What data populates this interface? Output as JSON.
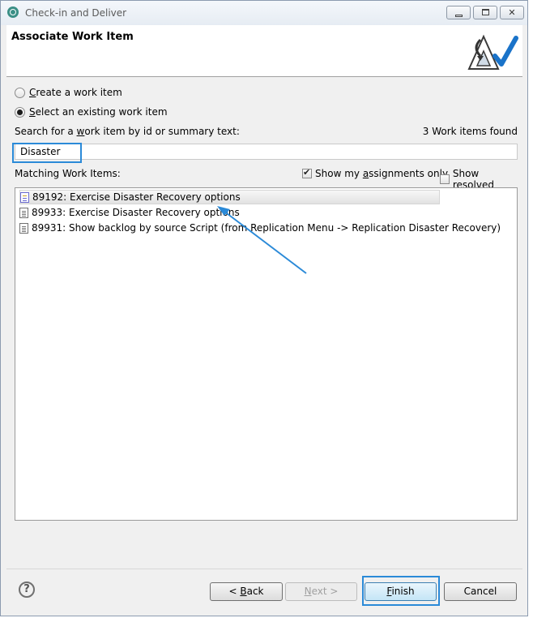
{
  "window": {
    "title": "Check-in and Deliver",
    "controls": {
      "minimize": "",
      "maximize": "",
      "close": "✕"
    }
  },
  "header": {
    "title": "Associate Work Item"
  },
  "options": {
    "create_pre": "",
    "create_u": "C",
    "create_post": "reate a work item",
    "select_pre": "",
    "select_u": "S",
    "select_post": "elect an existing work item",
    "selected": "select_existing"
  },
  "search": {
    "label_pre": "Search for a ",
    "label_u": "w",
    "label_post": "ork item by id or summary text:",
    "value": "Disaster",
    "found_text": "3 Work items found"
  },
  "matching": {
    "label": "Matching Work Items:",
    "show_mine_pre": "Show my ",
    "show_mine_u": "a",
    "show_mine_post": "ssignments only",
    "show_mine_checked": true,
    "show_resolved_pre": "Show ",
    "show_resolved_u": "r",
    "show_resolved_post": "esolved",
    "show_resolved_checked": false
  },
  "work_items": [
    {
      "text": "89192: Exercise Disaster Recovery options",
      "icon": "story-icon",
      "selected": true
    },
    {
      "text": "89933: Exercise Disaster Recovery options",
      "icon": "task-icon",
      "selected": false
    },
    {
      "text": "89931: Show backlog by source Script (from Replication Menu -> Replication Disaster Recovery)",
      "icon": "task-icon",
      "selected": false
    }
  ],
  "buttons": {
    "back_pre": "< ",
    "back_u": "B",
    "back_post": "ack",
    "next_pre": "",
    "next_u": "N",
    "next_post": "ext >",
    "finish_pre": "",
    "finish_u": "F",
    "finish_post": "inish",
    "cancel": "Cancel",
    "help": "?"
  },
  "colors": {
    "highlight": "#2b8ad8",
    "arrow": "#2b8ad8"
  }
}
